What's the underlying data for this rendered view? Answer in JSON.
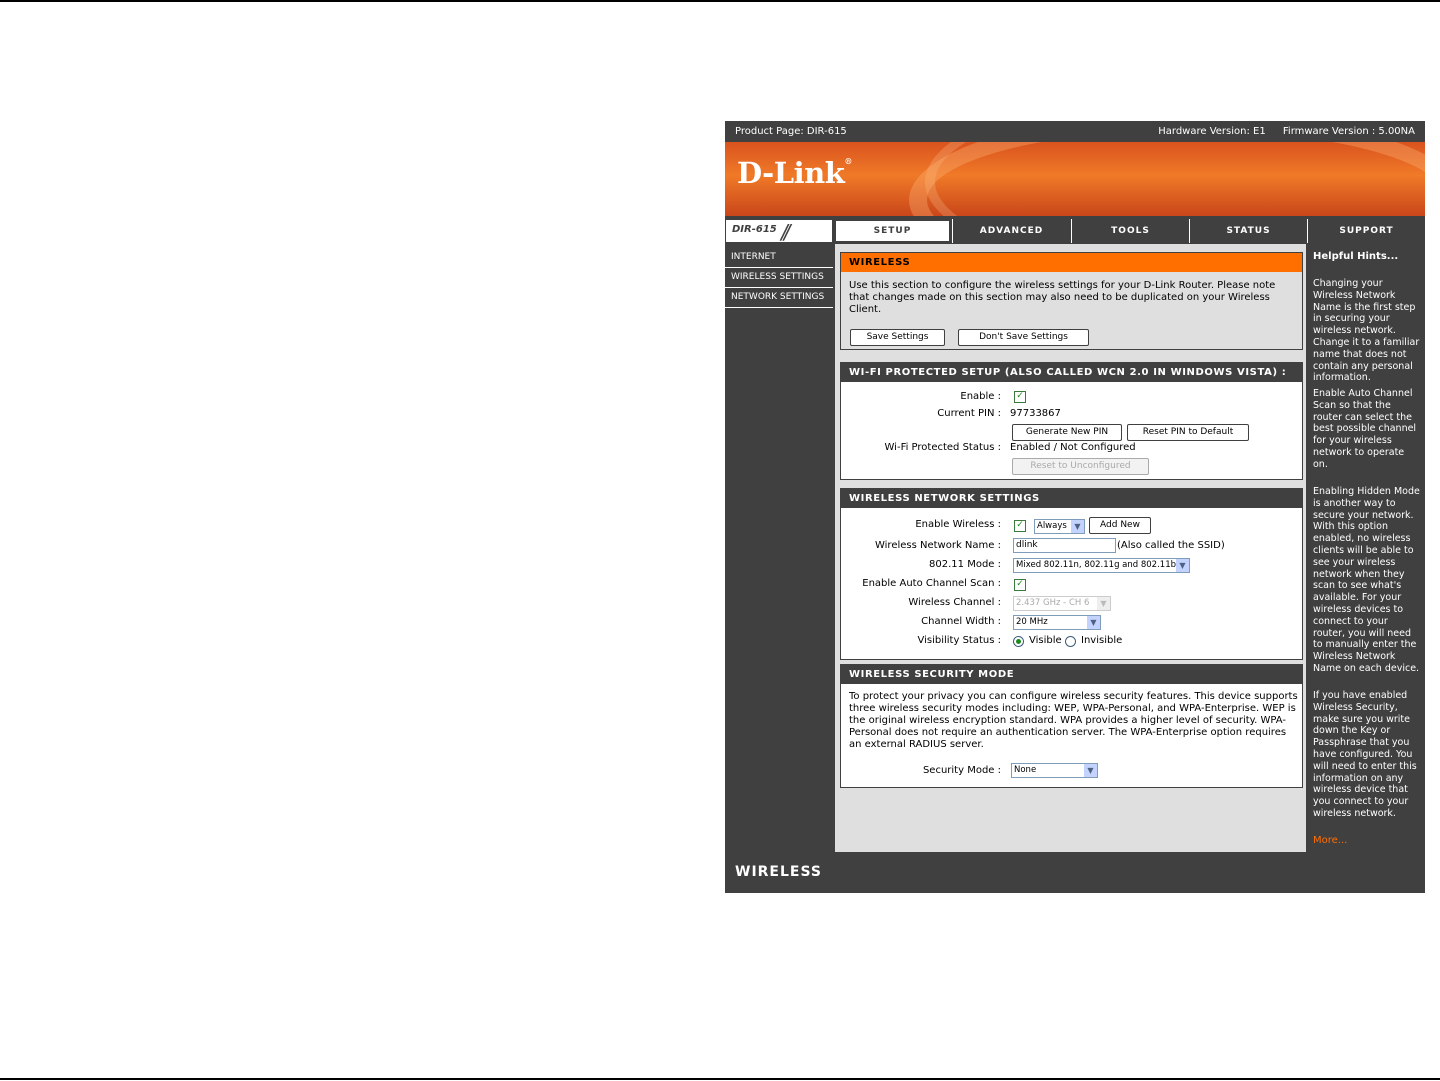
{
  "topbar": {
    "product_page": "Product Page: DIR-615",
    "hardware_version": "Hardware Version: E1",
    "firmware_version": "Firmware Version : 5.00NA"
  },
  "brand": {
    "logo": "D-Link",
    "model": "DIR-615"
  },
  "tabs": [
    {
      "label": "SETUP"
    },
    {
      "label": "ADVANCED"
    },
    {
      "label": "TOOLS"
    },
    {
      "label": "STATUS"
    },
    {
      "label": "SUPPORT"
    }
  ],
  "sidebar": {
    "items": [
      {
        "label": "INTERNET"
      },
      {
        "label": "WIRELESS SETTINGS"
      },
      {
        "label": "NETWORK SETTINGS"
      }
    ]
  },
  "wireless": {
    "title": "WIRELESS",
    "description": "Use this section to configure the wireless settings for your D-Link Router. Please note that changes made on this section may also need to be duplicated on your Wireless Client.",
    "save_label": "Save Settings",
    "dont_save_label": "Don't Save Settings"
  },
  "wps": {
    "title": "WI-FI PROTECTED SETUP (ALSO CALLED WCN 2.0 IN WINDOWS VISTA) :",
    "enable_label": "Enable :",
    "pin_label": "Current PIN :",
    "pin_value": "97733867",
    "generate_label": "Generate New PIN",
    "reset_pin_label": "Reset PIN to Default",
    "status_label": "Wi-Fi Protected Status :",
    "status_value": "Enabled / Not Configured",
    "reset_unconfigured_label": "Reset to Unconfigured"
  },
  "network": {
    "title": "WIRELESS NETWORK SETTINGS",
    "enable_label": "Enable Wireless :",
    "schedule_value": "Always",
    "add_new_label": "Add New",
    "ssid_label": "Wireless Network Name :",
    "ssid_value": "dlink",
    "ssid_note": "(Also called the SSID)",
    "mode_label": "802.11 Mode :",
    "mode_value": "Mixed 802.11n, 802.11g and 802.11b",
    "auto_channel_label": "Enable Auto Channel Scan :",
    "channel_label": "Wireless Channel :",
    "channel_value": "2.437 GHz - CH 6",
    "width_label": "Channel Width :",
    "width_value": "20 MHz",
    "visibility_label": "Visibility Status :",
    "visible_label": "Visible",
    "invisible_label": "Invisible"
  },
  "security": {
    "title": "WIRELESS SECURITY MODE",
    "description": "To protect your privacy you can configure wireless security features. This device supports three wireless security modes including: WEP, WPA-Personal, and WPA-Enterprise. WEP is the original wireless encryption standard. WPA provides a higher level of security. WPA-Personal does not require an authentication server. The WPA-Enterprise option requires an external RADIUS server.",
    "mode_label": "Security Mode :",
    "mode_value": "None"
  },
  "hints": {
    "title": "Helpful Hints...",
    "items": [
      "Changing your Wireless Network Name is the first step in securing your wireless network. Change it to a familiar name that does not contain any personal information.",
      "Enable Auto Channel Scan so that the router can select the best possible channel for your wireless network to operate on.",
      "Enabling Hidden Mode is another way to secure your network. With this option enabled, no wireless clients will be able to see your wireless network when they scan to see what's available. For your wireless devices to connect to your router, you will need to manually enter the Wireless Network Name on each device.",
      "If you have enabled Wireless Security, make sure you write down the Key or Passphrase that you have configured. You will need to enter this information on any wireless device that you connect to your wireless network."
    ],
    "more": "More..."
  },
  "footer": {
    "label": "WIRELESS"
  },
  "colors": {
    "dark": "#404040",
    "accent": "#ff6f00",
    "panel": "#dfdfdf"
  },
  "icons": {
    "check": "check-icon",
    "dropdown": "chevron-down-icon"
  }
}
